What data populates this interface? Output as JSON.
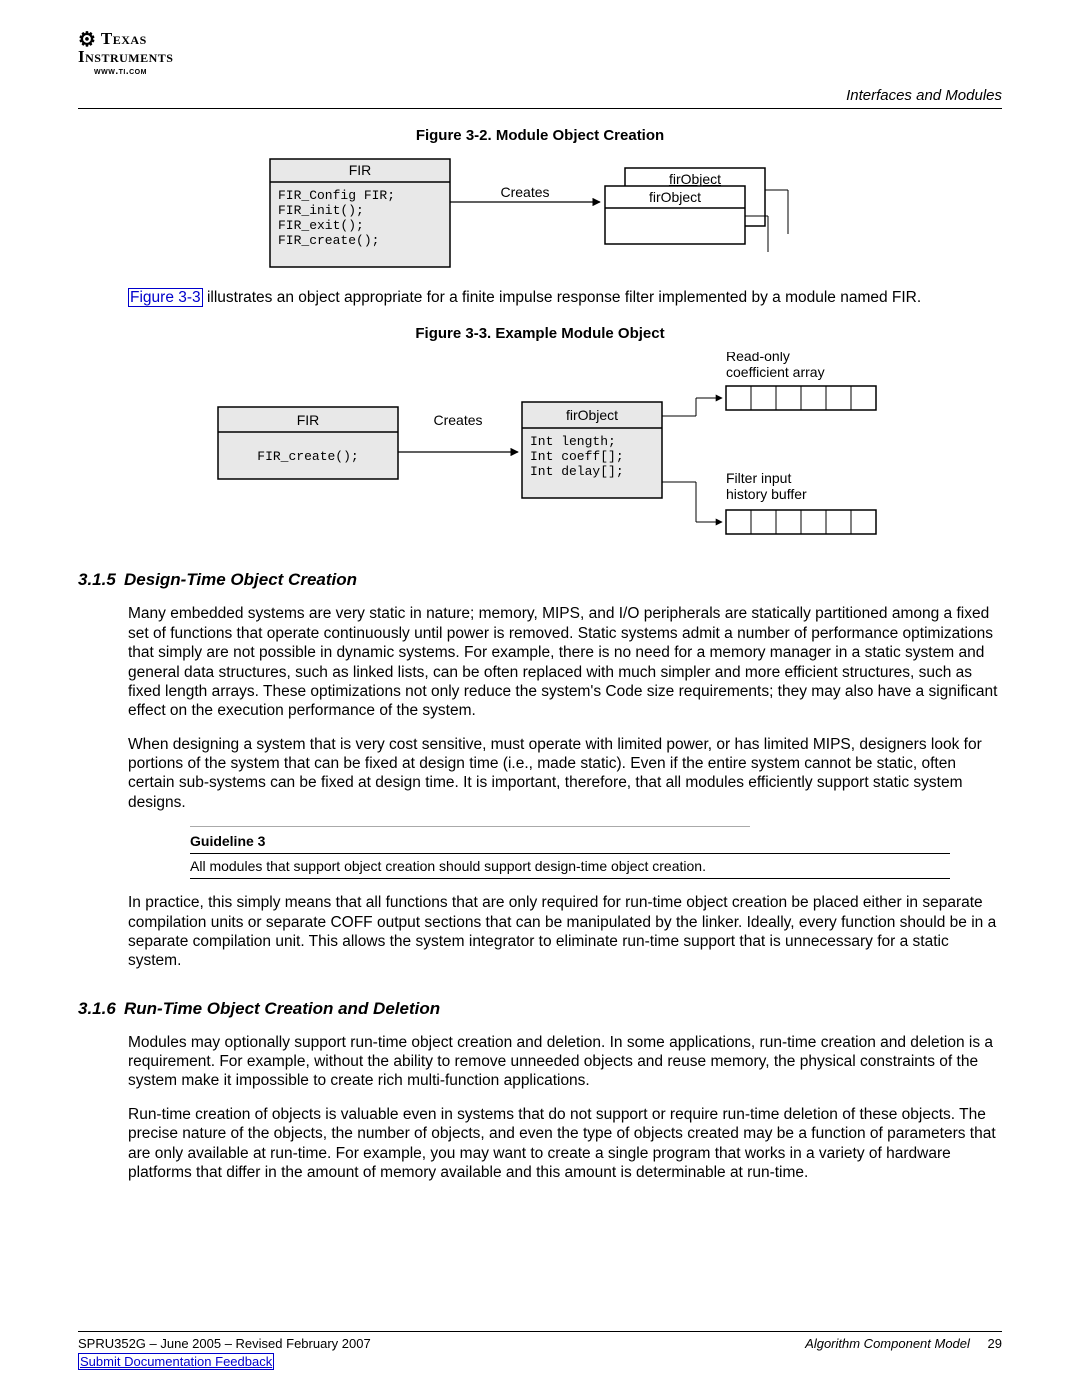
{
  "header": {
    "logo_line1": "Texas",
    "logo_line2": "Instruments",
    "url": "www.ti.com",
    "section": "Interfaces and Modules"
  },
  "figure32": {
    "caption": "Figure 3-2. Module Object Creation",
    "box_title": "FIR",
    "box_body": "FIR_Config FIR;\nFIR_init();\nFIR_exit();\nFIR_create();",
    "arrow_label": "Creates",
    "obj_back": "firObject",
    "obj_front": "firObject"
  },
  "para_fig33_intro_link": "Figure 3-3",
  "para_fig33_intro_rest": " illustrates an object appropriate for a finite impulse response filter implemented by a module named FIR.",
  "figure33": {
    "caption": "Figure 3-3. Example Module Object",
    "left_title": "FIR",
    "left_body": "FIR_create();",
    "arrow_label": "Creates",
    "obj_title": "firObject",
    "obj_body": "Int length;\nInt coeff[];\nInt delay[];",
    "note_top": "Read-only\ncoefficient array",
    "note_bottom": "Filter input\nhistory buffer"
  },
  "sec315": {
    "num": "3.1.5",
    "title": "Design-Time Object Creation",
    "p1": "Many embedded systems are very static in nature; memory, MIPS, and I/O peripherals are statically partitioned among a fixed set of functions that operate continuously until power is removed. Static systems admit a number of performance optimizations that simply are not possible in dynamic systems. For example, there is no need for a memory manager in a static system and general data structures, such as linked lists, can be often replaced with much simpler and more efficient structures, such as fixed length arrays. These optimizations not only reduce the system's Code size requirements; they may also have a significant effect on the execution performance of the system.",
    "p2": "When designing a system that is very cost sensitive, must operate with limited power, or has limited MIPS, designers look for portions of the system that can be fixed at design time (i.e., made static). Even if the entire system cannot be static, often certain sub-systems can be fixed at design time. It is important, therefore, that all modules efficiently support static system designs.",
    "guideline_label": "Guideline 3",
    "guideline_text": "All modules that support object creation should support design-time object creation.",
    "p3": "In practice, this simply means that all functions that are only required for run-time object creation be placed either in separate compilation units or separate COFF output sections that can be manipulated by the linker. Ideally, every function should be in a separate compilation unit. This allows the system integrator to eliminate run-time support that is unnecessary for a static system."
  },
  "sec316": {
    "num": "3.1.6",
    "title": "Run-Time Object Creation and Deletion",
    "p1": "Modules may optionally support run-time object creation and deletion. In some applications, run-time creation and deletion is a requirement. For example, without the ability to remove unneeded objects and reuse memory, the physical constraints of the system make it impossible to create rich multi-function applications.",
    "p2": "Run-time creation of objects is valuable even in systems that do not support or require run-time deletion of these objects. The precise nature of the objects, the number of objects, and even the type of objects created may be a function of parameters that are only available at run-time. For example, you may want to create a single program that works in a variety of hardware platforms that differ in the amount of memory available and this amount is determinable at run-time."
  },
  "footer": {
    "left": "SPRU352G – June 2005 – Revised February 2007",
    "right_title": "Algorithm Component Model",
    "page": "29",
    "feedback": "Submit Documentation Feedback"
  }
}
